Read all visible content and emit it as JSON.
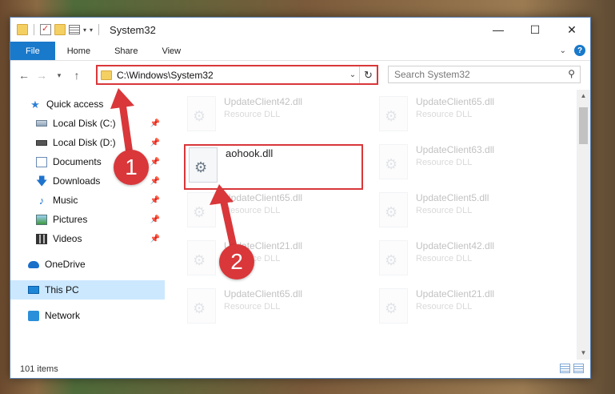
{
  "window": {
    "title": "System32",
    "controls": {
      "minimize": "—",
      "maximize": "☐",
      "close": "✕"
    }
  },
  "ribbon": {
    "tabs": [
      "File",
      "Home",
      "Share",
      "View"
    ],
    "help": "?"
  },
  "address_bar": {
    "path": "C:\\Windows\\System32",
    "search_placeholder": "Search System32"
  },
  "nav_pane": {
    "items": [
      {
        "label": "Quick access",
        "icon": "star-icon"
      },
      {
        "label": "Local Disk (C:)",
        "icon": "drive-icon",
        "pinned": true
      },
      {
        "label": "Local Disk (D:)",
        "icon": "drive-icon",
        "pinned": true
      },
      {
        "label": "Documents",
        "icon": "documents-icon",
        "pinned": true
      },
      {
        "label": "Downloads",
        "icon": "downloads-icon",
        "pinned": true
      },
      {
        "label": "Music",
        "icon": "music-icon",
        "pinned": true
      },
      {
        "label": "Pictures",
        "icon": "pictures-icon",
        "pinned": true
      },
      {
        "label": "Videos",
        "icon": "videos-icon",
        "pinned": true
      },
      {
        "label": "OneDrive",
        "icon": "onedrive-icon"
      },
      {
        "label": "This PC",
        "icon": "this-pc-icon",
        "selected": true
      },
      {
        "label": "Network",
        "icon": "network-icon"
      }
    ]
  },
  "files": [
    {
      "name": "UpdateClient42.dll",
      "type": "Resource DLL"
    },
    {
      "name": "UpdateClient65.dll",
      "type": "Resource DLL"
    },
    {
      "name": "aohook.dll",
      "type": ""
    },
    {
      "name": "UpdateClient63.dll",
      "type": "Resource DLL"
    },
    {
      "name": "UpdateClient65.dll",
      "type": "Resource DLL"
    },
    {
      "name": "UpdateClient5.dll",
      "type": "Resource DLL"
    },
    {
      "name": "UpdateClient21.dll",
      "type": "Resource DLL"
    },
    {
      "name": "UpdateClient42.dll",
      "type": "Resource DLL"
    },
    {
      "name": "UpdateClient65.dll",
      "type": "Resource DLL"
    },
    {
      "name": "UpdateClient21.dll",
      "type": "Resource DLL"
    }
  ],
  "status": {
    "item_count": "101 items"
  },
  "annotations": {
    "step1": "1",
    "step2": "2"
  },
  "colors": {
    "accent": "#1979ca",
    "highlight": "#d9373a",
    "selected": "#cce8ff"
  }
}
